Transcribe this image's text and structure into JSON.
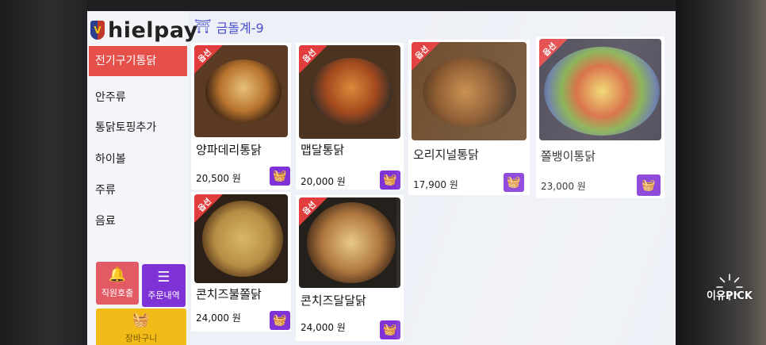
{
  "app": {
    "brand": "hielpay",
    "table": "금돌계-9"
  },
  "categories": [
    {
      "label": "전기구기통닭",
      "active": true
    },
    {
      "label": "안주류",
      "active": false
    },
    {
      "label": "통닭토핑추가",
      "active": false
    },
    {
      "label": "하이볼",
      "active": false
    },
    {
      "label": "주류",
      "active": false
    },
    {
      "label": "음료",
      "active": false
    }
  ],
  "actions": {
    "call_staff": "직원호출",
    "order_history": "주문내역",
    "cart": "장바구니"
  },
  "ribbon": "옵션",
  "menu": [
    {
      "name": "양파데리통닭",
      "price": "20,500 원",
      "ribbon": true
    },
    {
      "name": "맵달통닭",
      "price": "20,000 원",
      "ribbon": true
    },
    {
      "name": "오리지널통닭",
      "price": "17,900 원",
      "ribbon": true
    },
    {
      "name": "쫄뱅이통닭",
      "price": "23,000 원",
      "ribbon": true
    },
    {
      "name": "콘치즈불쫄닭",
      "price": "24,000 원",
      "ribbon": true
    },
    {
      "name": "콘치즈달달닭",
      "price": "24,000 원",
      "ribbon": true
    }
  ],
  "watermark": "이유PICK",
  "colors": {
    "active_category": "#e5504a",
    "accent_purple": "#7f33d6",
    "call": "#e25a64",
    "cart": "#f2bb18",
    "ribbon": "#e23d3d"
  }
}
